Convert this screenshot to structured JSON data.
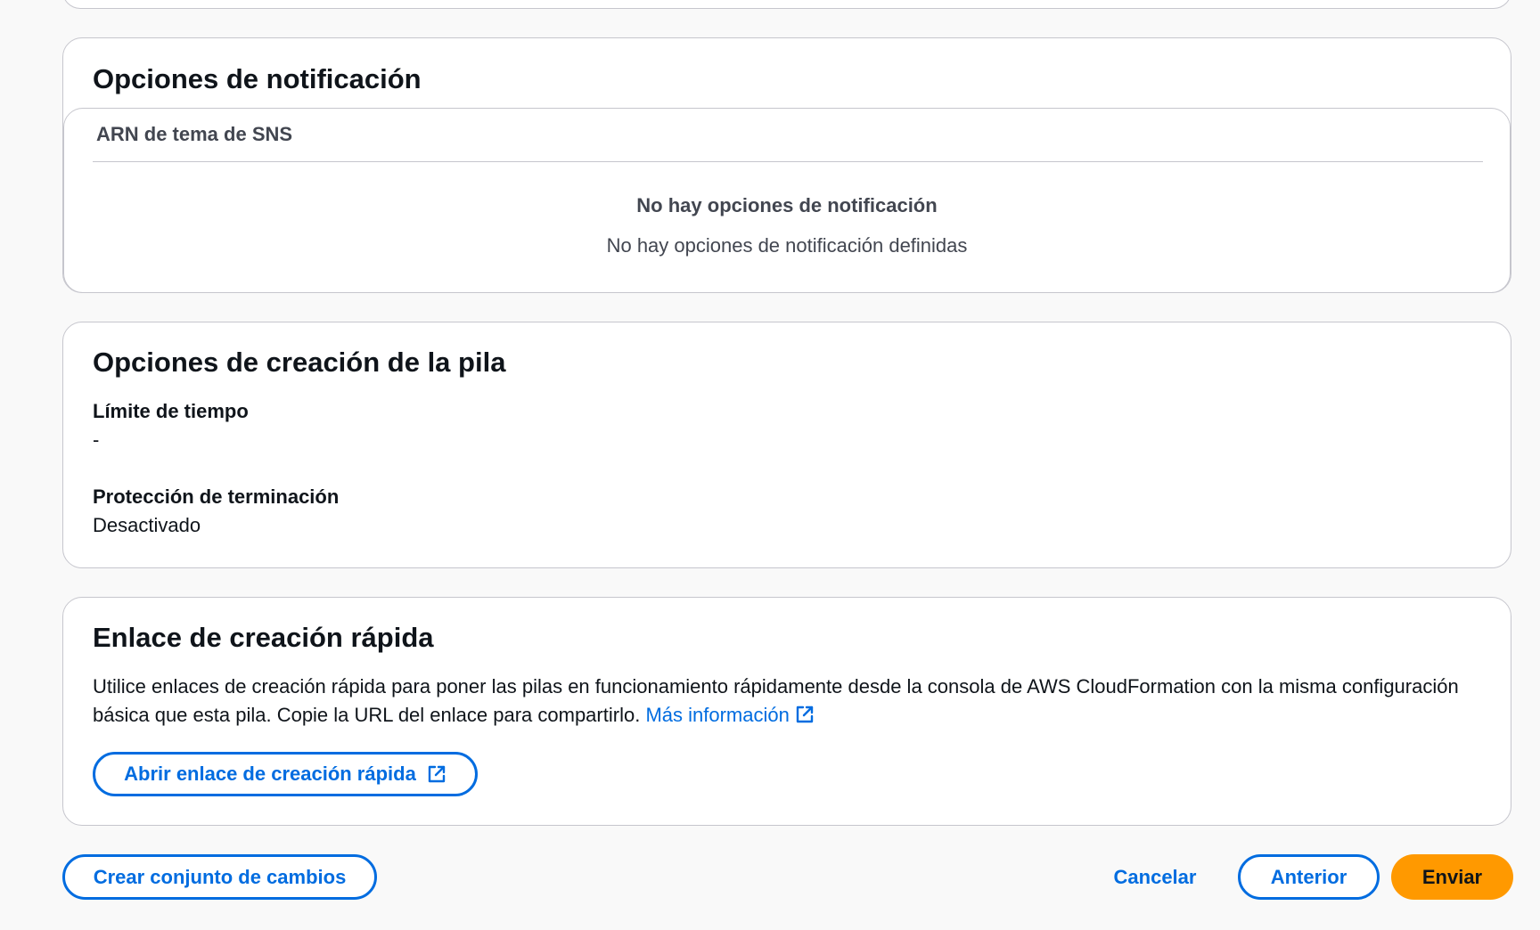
{
  "notification_options": {
    "title": "Opciones de notificación",
    "table_header": "ARN de tema de SNS",
    "empty_title": "No hay opciones de notificación",
    "empty_description": "No hay opciones de notificación definidas"
  },
  "stack_creation_options": {
    "title": "Opciones de creación de la pila",
    "timeout_label": "Límite de tiempo",
    "timeout_value": "-",
    "termination_protection_label": "Protección de terminación",
    "termination_protection_value": "Desactivado"
  },
  "quick_create_link": {
    "title": "Enlace de creación rápida",
    "description": "Utilice enlaces de creación rápida para poner las pilas en funcionamiento rápidamente desde la consola de AWS CloudFormation con la misma configuración básica que esta pila. Copie la URL del enlace para compartirlo.",
    "learn_more_label": "Más información",
    "open_button_label": "Abrir enlace de creación rápida",
    "icon": "external-link-icon"
  },
  "footer": {
    "create_change_set_label": "Crear conjunto de cambios",
    "cancel_label": "Cancelar",
    "previous_label": "Anterior",
    "submit_label": "Enviar"
  },
  "colors": {
    "link": "#006ce0",
    "primary_button": "#ff9900",
    "border": "#c6c6cd",
    "background": "#f9f9f9"
  }
}
